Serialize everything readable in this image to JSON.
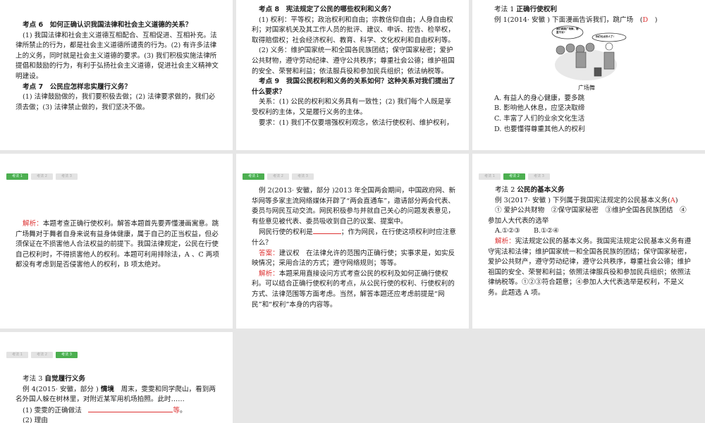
{
  "tabs": [
    "考法 1",
    "考法 2",
    "考法 3"
  ],
  "s1": {
    "h6": "考点 6　如何正确认识我国法律和社会主义道德的关系？",
    "p6": "(1) 我国法律和社会主义道德互相配合、互相促进、互相补充。法律所禁止的行为，都是社会主义道德所谴责的行为。(2) 有许多法律上的义务，同时就是社会主义道德的要求。(3) 我们积极实施法律所提倡和鼓励的行为，有利于弘扬社会主义道德，促进社会主义精神文明建设。",
    "h7": "考点 7　公民应怎样忠实履行义务？",
    "p7": "(1) 法律鼓励做的，我们要积极去做；(2) 法律要求做的，我们必须去做；(3) 法律禁止做的，我们坚决不做。"
  },
  "s2": {
    "h8": "考点 8　宪法规定了公民的哪些权利和义务？",
    "p1": "(1) 权利：平等权；政治权利和自由；宗教信仰自由；人身自由权利；对国家机关及其工作人员的批评、建议、申诉、控告、检举权，取得赔偿权；社会经济权利、教育、科学、文化权利和自由权利等。",
    "p2": "(2) 义务：维护国家统一和全国各民族团结；保守国家秘密；爱护公共财物，遵守劳动纪律、遵守公共秩序；尊重社会公德；维护祖国的安全、荣誉和利益；依法服兵役和参加民兵组织；依法纳税等。",
    "h9": "考点 9　我国公民权利和义务的关系如何？这种关系对我们提出了什么要求？",
    "p3": "关系：(1) 公民的权利和义务具有一致性；(2) 我们每个人既是享受权利的主体，又是履行义务的主体。",
    "p4": "要求：(1) 我们不仅要增强权利观念，依法行使权利、维护权利，"
  },
  "s3": {
    "title_pre": "考法 1 ",
    "title": "正确行使权利",
    "q": "例 1(2014· 安徽 ) 下面漫画告诉我们，跳广场",
    "ans": "D",
    "bubble1": "我们跳跳广场舞，哪里不对?",
    "bubble2": "你们也太吵人了!",
    "caption": "广场舞",
    "options": [
      "A. 有益人的身心健康，要多跳",
      "B. 影响他人休息，应坚决取缔",
      "C. 丰富了人们的业余文化生活",
      "D. 也要懂得尊重其他人的权利"
    ]
  },
  "s4": {
    "label": "解析：",
    "text": "本题考查正确行使权利。解答本题首先要弄懂漫画寓意。跳广场舞对于舞者自身来说有益身体健康，属于自己的正当权益，但必须保证在不损害他人合法权益的前提下。我国法律规定，公民在行使自己权利时，不得损害他人的权利。本题可利用排除法，A 、C 两项都没有考虑到是否侵害他人的权利，B 项太绝对。"
  },
  "s5": {
    "q": "例 2(2013· 安徽，部分 )2013 年全国两会期间，中国政府网、新华网等多家主流网络媒体开辟了“两会直通车”，邀请部分两会代表、委员与网民互动交流。网民积极参与并就自己关心的问题发表意见，有些意见被代表、委员吸收到自己的议案、提案中。",
    "q2a": "网民行使的权利是",
    "q2b": "；作为网民，在行使这项权利时应注意什么？",
    "ans_label": "答案：",
    "ans": "建议权　在法律允许的范围内正确行使；实事求是，如实反映情况；采用合法的方式；遵守网络规则；等等。",
    "ana_label": "解析：",
    "ana": "本题采用直接设问方式考查公民的权利及如何正确行使权利。可以结合正确行使权利的考点，从公民行使的权利、行使权利的方式、法律范围等方面考虑。当然，解答本题还应考虑前提是“网民”和“权利”本身的内容等。"
  },
  "s6": {
    "title_pre": "考法 2 ",
    "title": "公民的基本义务",
    "q": "例 3(2017· 安徽 ) 下列属于我国宪法规定的公民基本义务(",
    "ans": "A",
    "q_end": ")",
    "items": "① 爱护公共财物　②保守国家秘密　③维护全国各民族团结　④参加人大代表的选举",
    "optA": "A.①②③",
    "optB": "B.①②④",
    "ana_label": "解析：",
    "ana": "宪法规定公民的基本义务。我国宪法规定公民基本义务有遵守宪法和法律；维护国家统一和全国各民族的团结；保守国家秘密，爱护公共财产，遵守劳动纪律，遵守公共秩序，尊重社会公德；维护祖国的安全、荣誉和利益；依照法律服兵役和参加民兵组织；依照法律纳税等。①②③符合题意；④参加人大代表选举是权利，不是义务。此题选 A 项。"
  },
  "s7": {
    "title_pre": "考法 3 ",
    "title": "自觉履行义务",
    "q_pre": "例 4(2015· 安徽，部分 ) ",
    "q_b": "情境",
    "q": "　周末，雯雯和同学爬山，看到两名外国人躲在树林里，对附近某军用机场拍照。此时……",
    "l1": "(1) 雯雯的正确做法",
    "l1ans": "等",
    "l2": "(2) 理由"
  }
}
